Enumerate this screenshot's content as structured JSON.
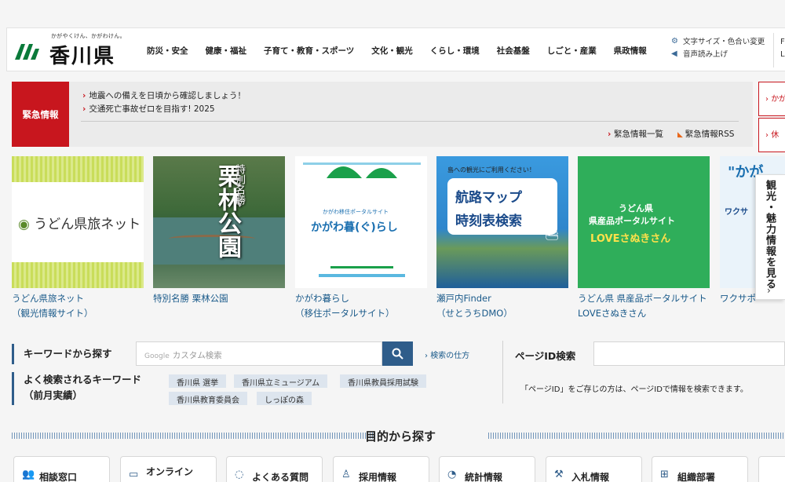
{
  "header": {
    "tagline": "かがやくけん、かがわけん。",
    "site_name": "香川県",
    "nav": [
      "防災・安全",
      "健康・福祉",
      "子育て・教育・スポーツ",
      "文化・観光",
      "くらし・環境",
      "社会基盤",
      "しごと・産業",
      "県政情報"
    ],
    "util": {
      "text_size": "文字サイズ・色合い変更",
      "read_aloud": "音声読み上げ"
    },
    "clipped": [
      "F",
      "L"
    ]
  },
  "emergency": {
    "label": "緊急情報",
    "items": [
      "地震への備えを日頃から確認しましょう！",
      "交通死亡事故ゼロを目指す! 2025"
    ],
    "list_link": "緊急情報一覧",
    "rss_link": "緊急情報RSS",
    "side_buttons": [
      "かが",
      "休"
    ]
  },
  "banners": [
    {
      "text": "うどん県旅ネット",
      "caption1": "うどん県旅ネット",
      "caption2": "（観光情報サイト）"
    },
    {
      "title": "栗林公園",
      "sub": "特別名勝",
      "caption1": "特別名勝 栗林公園",
      "caption2": ""
    },
    {
      "sub": "かがわ移住ポータルサイト",
      "title": "かがわ暮(ぐ)らし",
      "caption1": "かがわ暮らし",
      "caption2": "（移住ポータルサイト）"
    },
    {
      "top": "島への観光にご利用ください！",
      "line1": "航路マップ",
      "line2": "時刻表検索",
      "caption1": "瀬戸内Finder",
      "caption2": "（せとうちDMO）"
    },
    {
      "line1": "うどん県",
      "line2": "県産品ポータルサイト",
      "line3": "LOVEさぬきさん",
      "caption1": "うどん県 県産品ポータルサイト",
      "caption2": "LOVEさぬきさん"
    },
    {
      "line1": "\"かが",
      "line2": "ワクサ",
      "caption1": "ワクサポ",
      "caption2": ""
    }
  ],
  "side_tab": {
    "text": "観光・魅力情報を見る",
    "arrow": "›"
  },
  "search": {
    "keyword_label": "キーワードから探す",
    "placeholder_google": "Google",
    "placeholder": "カスタム検索",
    "help": "検索の仕方",
    "popular_label_1": "よく検索されるキーワード",
    "popular_label_2": "（前月実績）",
    "keywords": [
      "香川県 選挙",
      "香川県立ミュージアム",
      "香川県教員採用試験",
      "香川県教育委員会",
      "しっぽの森"
    ],
    "page_id_label": "ページID検索",
    "page_id_note": "「ページID」をご存じの方は、ページIDで情報を検索できます。"
  },
  "purpose": {
    "title": "目的から探す",
    "cards": [
      {
        "label": "相談窓口",
        "icon": "people-icon"
      },
      {
        "label": "オンライン",
        "icon": "laptop-icon"
      },
      {
        "label": "よくある質問",
        "icon": "chat-icon"
      },
      {
        "label": "採用情報",
        "icon": "person-icon"
      },
      {
        "label": "統計情報",
        "icon": "chart-icon"
      },
      {
        "label": "入札情報",
        "icon": "gavel-icon"
      },
      {
        "label": "組織部署",
        "icon": "org-icon"
      }
    ]
  },
  "colors": {
    "accent": "#2f5d8a",
    "emergency": "#c8161e",
    "link": "#1a5a8a"
  }
}
